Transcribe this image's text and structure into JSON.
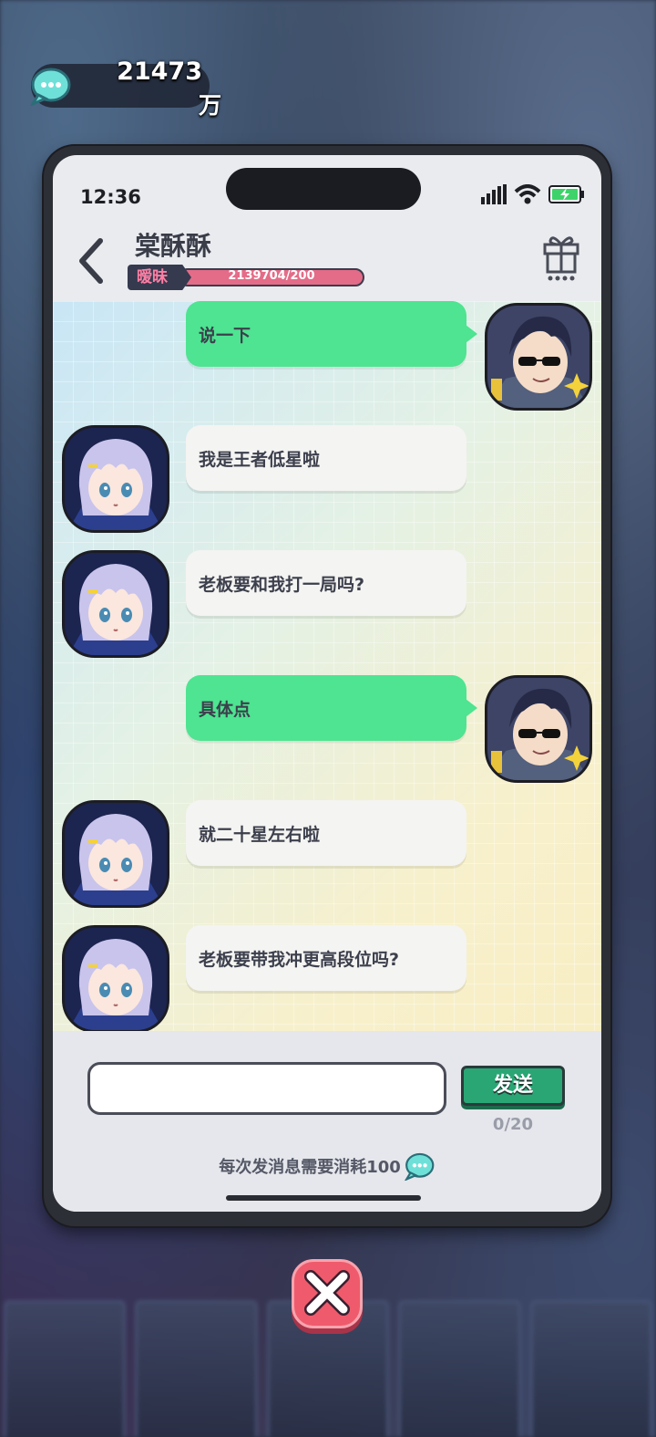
{
  "currency": {
    "amount": "21473",
    "unit": "万",
    "icon": "chat-bubble-coin-icon"
  },
  "status_bar": {
    "time": "12:36",
    "icons": [
      "signal-icon",
      "wifi-icon",
      "battery-charging-icon"
    ]
  },
  "header": {
    "contact_name": "棠酥酥",
    "affinity_label": "暧昧",
    "affinity_progress": "2139704/200",
    "back_icon": "back-arrow-icon",
    "gift_icon": "gift-icon"
  },
  "messages": [
    {
      "from": "me",
      "text": "说一下"
    },
    {
      "from": "contact",
      "text": "我是王者低星啦"
    },
    {
      "from": "contact",
      "text": "老板要和我打一局吗?"
    },
    {
      "from": "me",
      "text": "具体点"
    },
    {
      "from": "contact",
      "text": "就二十星左右啦"
    },
    {
      "from": "contact",
      "text": "老板要带我冲更高段位吗?"
    }
  ],
  "composer": {
    "input_value": "",
    "send_label": "发送",
    "char_count": "0/20",
    "cost_note": "每次发消息需要消耗100"
  },
  "colors": {
    "outgoing_bubble": "#4ee491",
    "incoming_bubble": "#f4f4f2",
    "send_button": "#2aa675",
    "close_button": "#ef5b6c",
    "affinity_bar": "#e46c88"
  }
}
